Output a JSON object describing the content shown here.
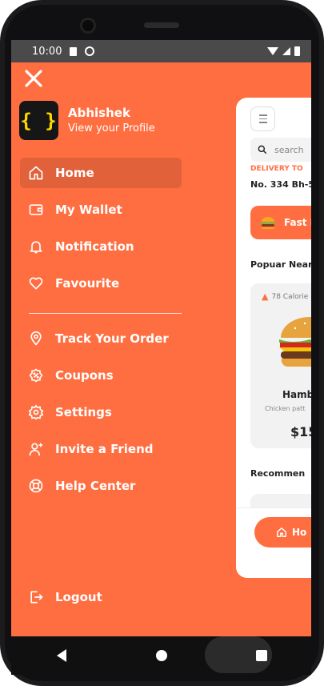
{
  "status_bar": {
    "time": "10:00"
  },
  "drawer": {
    "profile": {
      "name": "Abhishek",
      "subtitle": "View your Profile",
      "avatar_glyph": "{ }"
    },
    "menu_primary": [
      {
        "label": "Home",
        "icon": "home-icon",
        "active": true
      },
      {
        "label": "My Wallet",
        "icon": "wallet-icon"
      },
      {
        "label": "Notification",
        "icon": "bell-icon"
      },
      {
        "label": "Favourite",
        "icon": "heart-icon"
      }
    ],
    "menu_secondary": [
      {
        "label": "Track Your Order",
        "icon": "location-pin-icon"
      },
      {
        "label": "Coupons",
        "icon": "coupon-icon"
      },
      {
        "label": "Settings",
        "icon": "gear-icon"
      },
      {
        "label": "Invite a Friend",
        "icon": "add-user-icon"
      },
      {
        "label": "Help Center",
        "icon": "lifebuoy-icon"
      }
    ],
    "logout_label": "Logout"
  },
  "peek": {
    "search_placeholder": "search",
    "deliver_to": "DELIVERY TO",
    "address": "No. 334 Bh-5",
    "chip_label": "Fast F",
    "popular_heading": "Popuar Near",
    "card": {
      "calories": "78 Calorie",
      "name": "Hamb",
      "description": "Chicken patt",
      "price": "$15"
    },
    "recommended_heading": "Recommen",
    "nav_home_label": "Ho"
  },
  "colors": {
    "accent": "#FF6E40",
    "active_item": "#E0613A",
    "avatar_bg": "#161616",
    "avatar_fg": "#FFD600"
  }
}
